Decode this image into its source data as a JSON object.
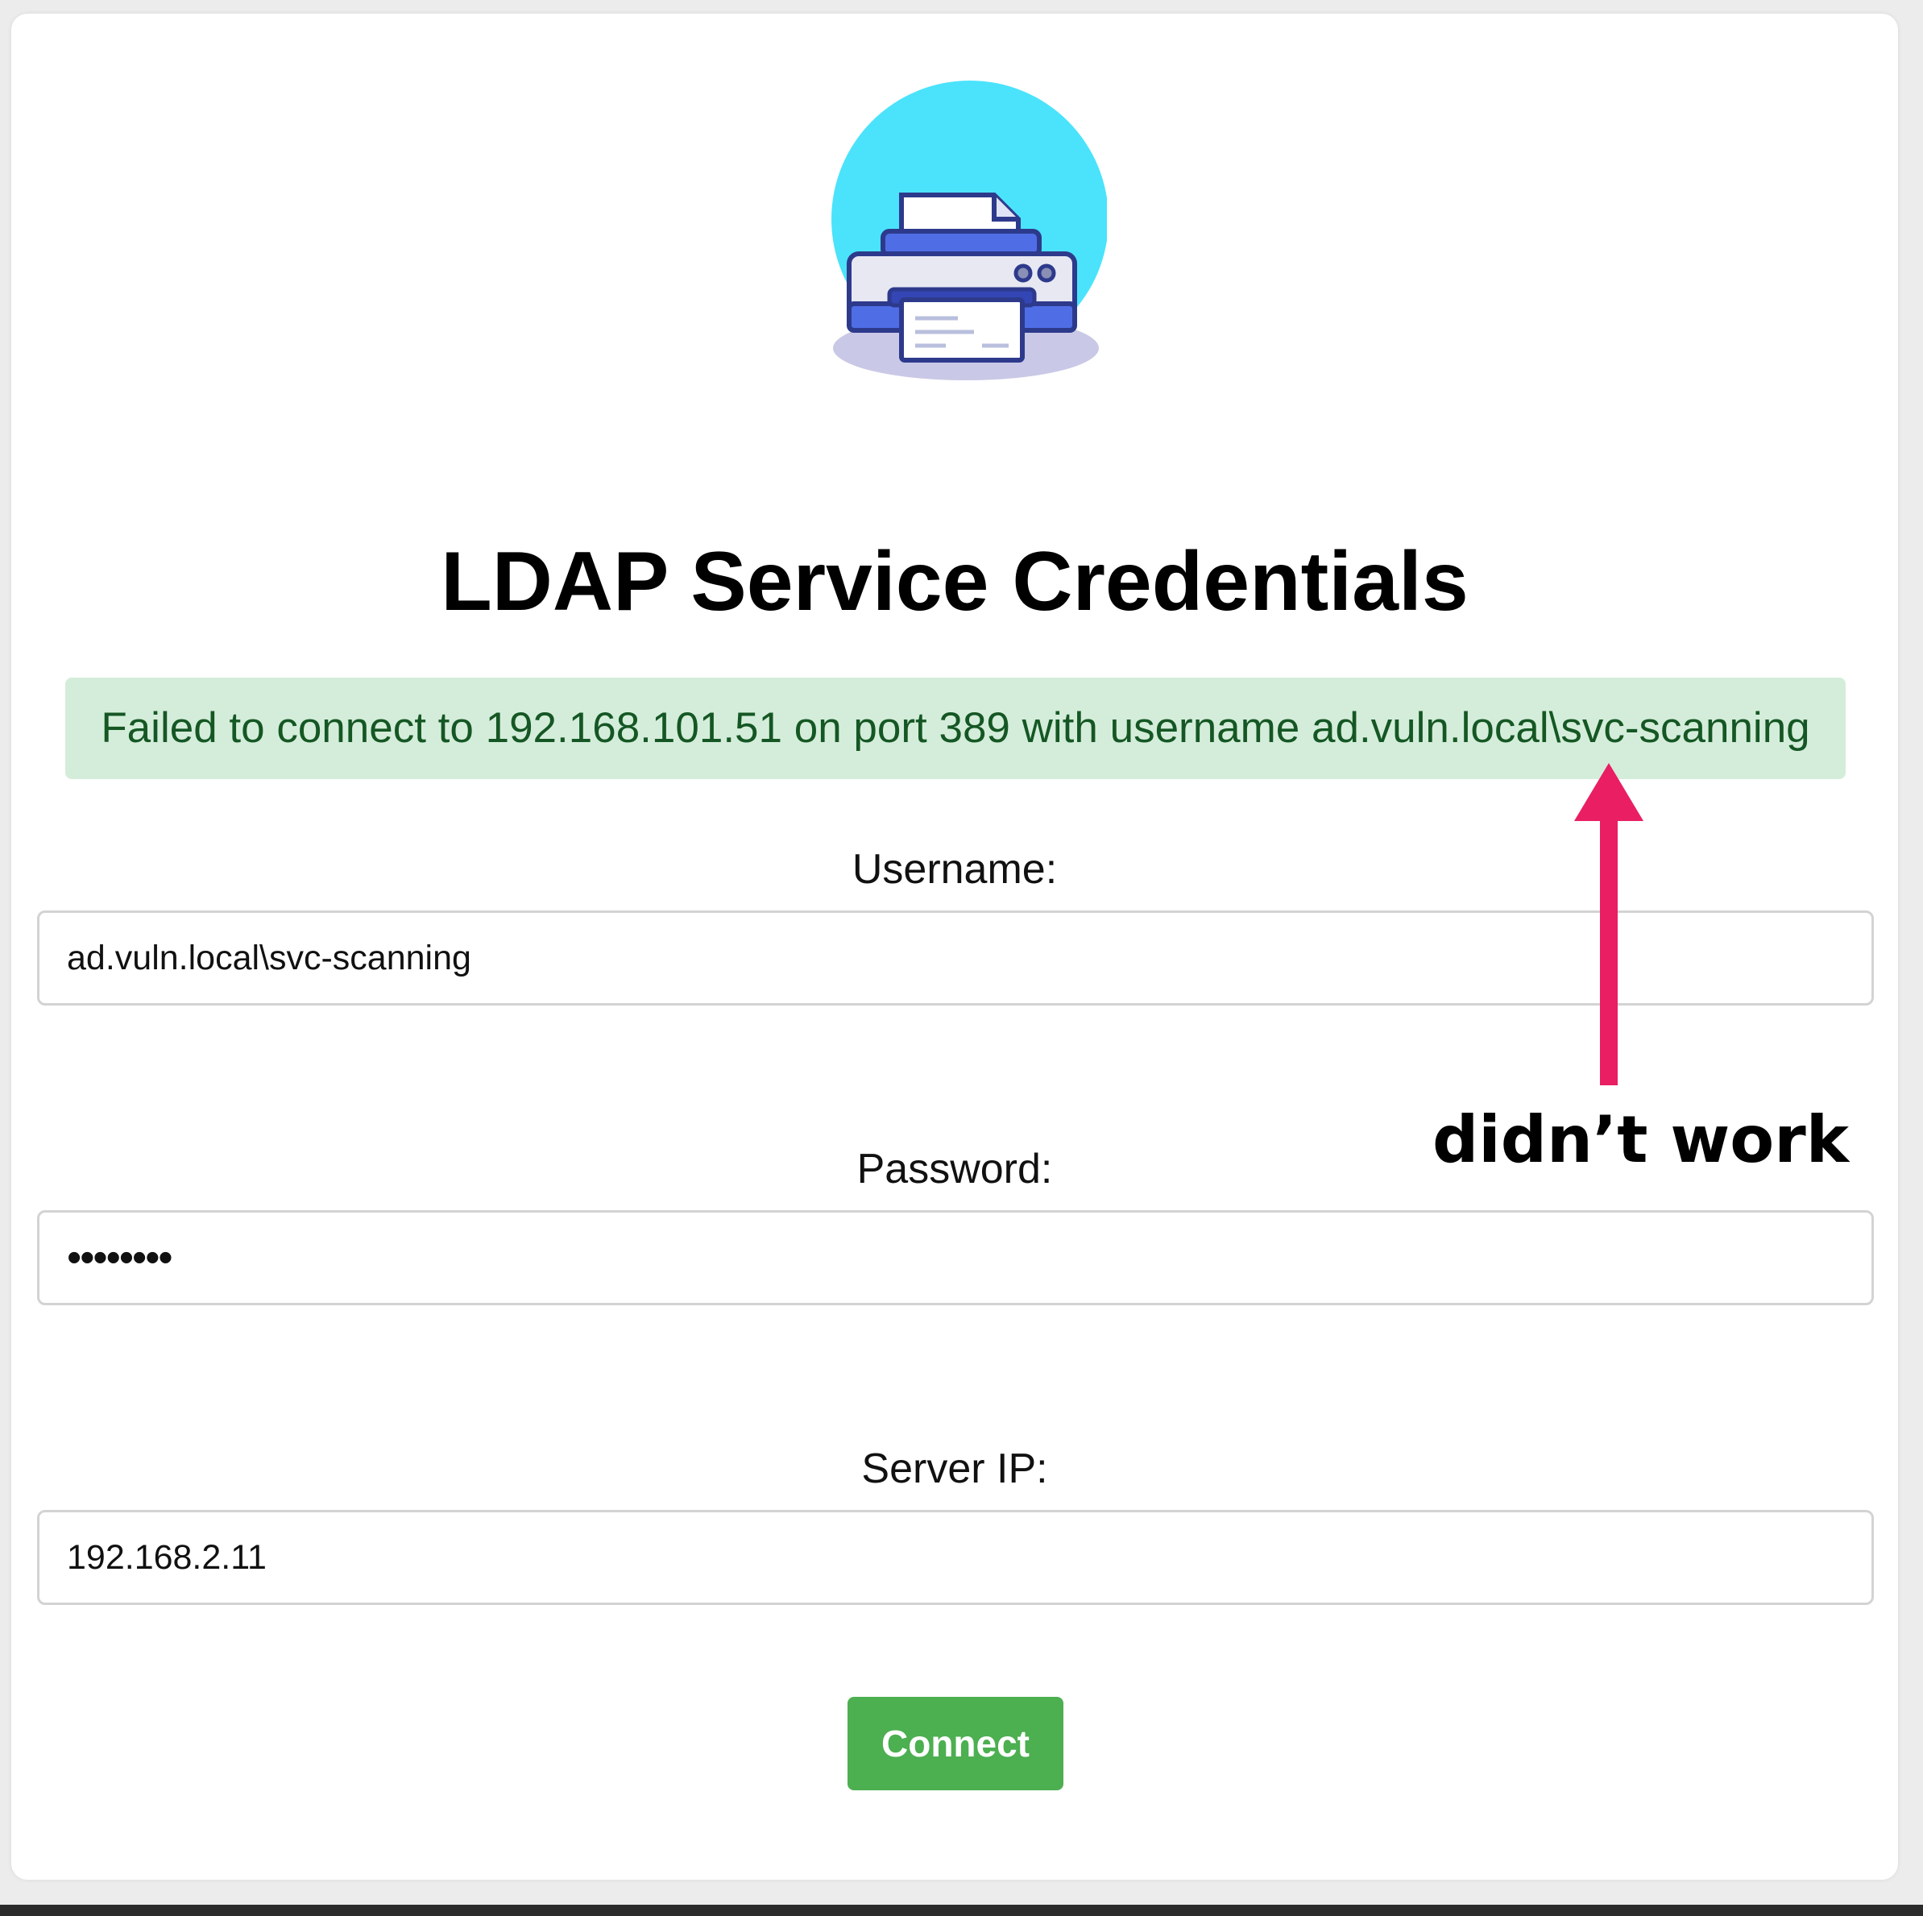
{
  "page": {
    "title": "LDAP Service Credentials",
    "alert_message": "Failed to connect to 192.168.101.51 on port 389 with username ad.vuln.local\\svc-scanning"
  },
  "form": {
    "username": {
      "label": "Username:",
      "value": "ad.vuln.local\\svc-scanning"
    },
    "password": {
      "label": "Password:",
      "value": "••••••••"
    },
    "server_ip": {
      "label": "Server IP:",
      "value": "192.168.2.11"
    },
    "submit_label": "Connect"
  },
  "annotation": {
    "text": "didn’t work",
    "color": "#e91e63"
  },
  "icons": {
    "logo": "printer-icon"
  },
  "colors": {
    "alert_background": "#d4edda",
    "alert_text": "#155724",
    "button_background": "#4caf50",
    "logo_circle": "#4ae3fb"
  }
}
